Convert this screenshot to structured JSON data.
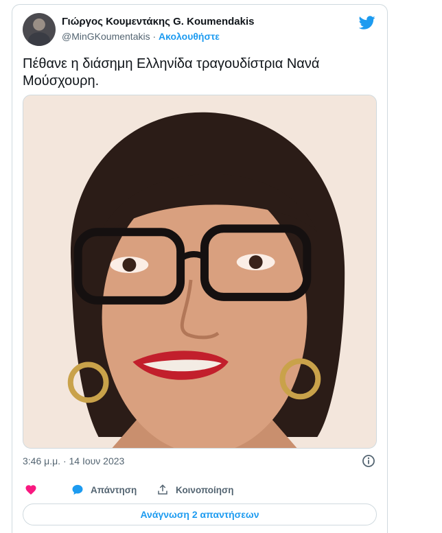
{
  "author": {
    "display_name": "Γιώργος Κουμεντάκης G. Koumendakis",
    "handle": "@MinGKoumentakis",
    "separator": "·",
    "follow_label": "Ακολουθήστε"
  },
  "tweet": {
    "text": "Πέθανε η διάσημη Ελληνίδα τραγουδίστρια Νανά Μούσχουρη.",
    "timestamp": "3:46 μ.μ. · 14 Ιουν 2023"
  },
  "actions": {
    "reply_label": "Απάντηση",
    "share_label": "Κοινοποίηση",
    "read_replies_label": "Ανάγνωση 2 απαντήσεων"
  },
  "colors": {
    "accent": "#1d9bf0",
    "like": "#f91880",
    "secondary_text": "#536471",
    "border": "#cfd9de"
  },
  "icons": {
    "brand": "twitter-bird-icon",
    "info": "info-icon",
    "like": "heart-icon",
    "reply": "speech-bubble-icon",
    "share": "share-arrow-icon"
  }
}
